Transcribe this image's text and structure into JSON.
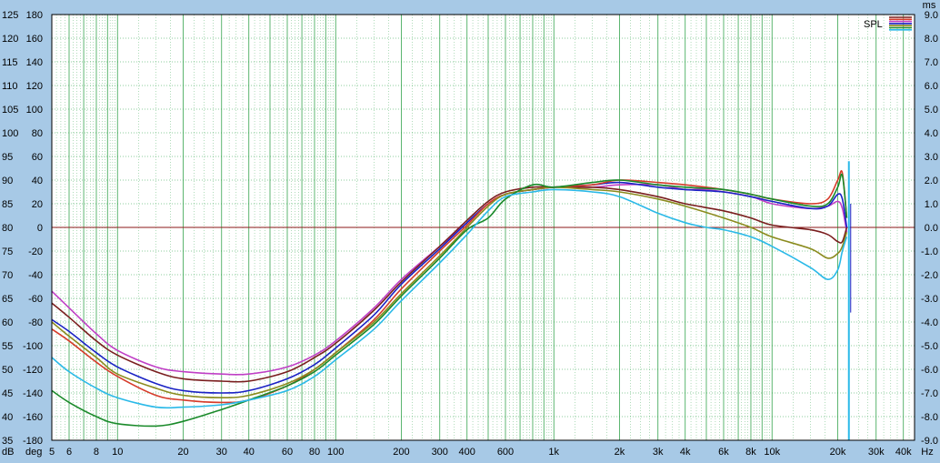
{
  "chart_data": {
    "type": "line",
    "x_scale": "log",
    "xlim": [
      5,
      45000
    ],
    "ylim_db": [
      35,
      125
    ],
    "ylim_deg": [
      -180,
      180
    ],
    "ylim_ms": [
      -9.0,
      9.0
    ],
    "left_units": [
      "dB",
      "deg"
    ],
    "right_unit": "ms",
    "x_unit": "Hz",
    "legend_label": "SPL",
    "colors": {
      "background": "#a7c9e6",
      "plot": "#ffffff",
      "grid": "#1f9a3a",
      "zero_line": "#8b1a1a"
    },
    "db_ticks": [
      "35",
      "40",
      "45",
      "50",
      "55",
      "60",
      "65",
      "70",
      "75",
      "80",
      "85",
      "90",
      "95",
      "100",
      "105",
      "110",
      "115",
      "120",
      "125"
    ],
    "deg_ticks": [
      "-180",
      "-160",
      "-140",
      "-120",
      "-100",
      "-80",
      "-60",
      "-40",
      "-20",
      "0",
      "20",
      "40",
      "60",
      "80",
      "100",
      "120",
      "140",
      "160",
      "180"
    ],
    "ms_ticks": [
      "-9.0",
      "-8.0",
      "-7.0",
      "-6.0",
      "-5.0",
      "-4.0",
      "-3.0",
      "-2.0",
      "-1.0",
      "0.0",
      "1.0",
      "2.0",
      "3.0",
      "4.0",
      "5.0",
      "6.0",
      "7.0",
      "8.0",
      "9.0"
    ],
    "x_ticks": [
      {
        "v": 5,
        "label": "5"
      },
      {
        "v": 6,
        "label": "6"
      },
      {
        "v": 8,
        "label": "8"
      },
      {
        "v": 10,
        "label": "10"
      },
      {
        "v": 20,
        "label": "20"
      },
      {
        "v": 30,
        "label": "30"
      },
      {
        "v": 40,
        "label": "40"
      },
      {
        "v": 60,
        "label": "60"
      },
      {
        "v": 80,
        "label": "80"
      },
      {
        "v": 100,
        "label": "100"
      },
      {
        "v": 200,
        "label": "200"
      },
      {
        "v": 300,
        "label": "300"
      },
      {
        "v": 400,
        "label": "400"
      },
      {
        "v": 600,
        "label": "600"
      },
      {
        "v": 1000,
        "label": "1k"
      },
      {
        "v": 2000,
        "label": "2k"
      },
      {
        "v": 3000,
        "label": "3k"
      },
      {
        "v": 4000,
        "label": "4k"
      },
      {
        "v": 6000,
        "label": "6k"
      },
      {
        "v": 8000,
        "label": "8k"
      },
      {
        "v": 10000,
        "label": "10k"
      },
      {
        "v": 20000,
        "label": "20k"
      },
      {
        "v": 30000,
        "label": "30k"
      },
      {
        "v": 40000,
        "label": "40k"
      }
    ],
    "series": [
      {
        "color": "#c03fc6",
        "points": [
          [
            5,
            66.5
          ],
          [
            6,
            63
          ],
          [
            8,
            57.5
          ],
          [
            10,
            54
          ],
          [
            15,
            50.5
          ],
          [
            20,
            49.5
          ],
          [
            30,
            49
          ],
          [
            40,
            49
          ],
          [
            60,
            50.5
          ],
          [
            80,
            53
          ],
          [
            100,
            56
          ],
          [
            150,
            63
          ],
          [
            200,
            69
          ],
          [
            300,
            76
          ],
          [
            400,
            81
          ],
          [
            500,
            85
          ],
          [
            600,
            87
          ],
          [
            800,
            88
          ],
          [
            1000,
            88.5
          ],
          [
            1500,
            88.5
          ],
          [
            2000,
            89
          ],
          [
            3000,
            89
          ],
          [
            4000,
            88
          ],
          [
            5000,
            88
          ],
          [
            8000,
            86.5
          ],
          [
            10000,
            85
          ],
          [
            15000,
            84
          ],
          [
            18000,
            84.5
          ],
          [
            20000,
            85.5
          ],
          [
            21000,
            84
          ],
          [
            22000,
            79
          ]
        ]
      },
      {
        "color": "#7a1f1f",
        "points": [
          [
            5,
            64
          ],
          [
            6,
            61
          ],
          [
            8,
            56
          ],
          [
            10,
            53
          ],
          [
            15,
            49.5
          ],
          [
            20,
            48
          ],
          [
            30,
            47.5
          ],
          [
            40,
            47.5
          ],
          [
            60,
            49.5
          ],
          [
            80,
            52.5
          ],
          [
            100,
            55.5
          ],
          [
            150,
            62.5
          ],
          [
            200,
            68.5
          ],
          [
            300,
            76
          ],
          [
            400,
            81.5
          ],
          [
            500,
            85.5
          ],
          [
            600,
            87.5
          ],
          [
            800,
            88.5
          ],
          [
            1000,
            88.5
          ],
          [
            1500,
            88.5
          ],
          [
            2000,
            88
          ],
          [
            3000,
            86.5
          ],
          [
            4000,
            85
          ],
          [
            6000,
            83.5
          ],
          [
            8000,
            82
          ],
          [
            10000,
            80.5
          ],
          [
            15000,
            79.5
          ],
          [
            18000,
            78.5
          ],
          [
            20000,
            77
          ],
          [
            21000,
            77
          ],
          [
            22000,
            80
          ]
        ]
      },
      {
        "color": "#1a22c4",
        "points": [
          [
            5,
            60.5
          ],
          [
            6,
            58
          ],
          [
            8,
            53.5
          ],
          [
            10,
            50.5
          ],
          [
            15,
            47
          ],
          [
            20,
            45.5
          ],
          [
            30,
            45
          ],
          [
            40,
            45.5
          ],
          [
            60,
            48
          ],
          [
            80,
            51
          ],
          [
            100,
            54.5
          ],
          [
            150,
            61.5
          ],
          [
            200,
            68
          ],
          [
            300,
            75.5
          ],
          [
            400,
            81
          ],
          [
            500,
            85
          ],
          [
            600,
            87
          ],
          [
            800,
            88
          ],
          [
            1000,
            88.5
          ],
          [
            1500,
            89
          ],
          [
            2000,
            89.5
          ],
          [
            3000,
            88.5
          ],
          [
            4000,
            88
          ],
          [
            6000,
            87.5
          ],
          [
            8000,
            86.5
          ],
          [
            10000,
            85.5
          ],
          [
            15000,
            84
          ],
          [
            18000,
            84.5
          ],
          [
            20000,
            87
          ],
          [
            21000,
            86
          ],
          [
            22000,
            80
          ]
        ]
      },
      {
        "color": "#d63b2a",
        "points": [
          [
            5,
            58.5
          ],
          [
            6,
            56
          ],
          [
            8,
            51.5
          ],
          [
            10,
            48.5
          ],
          [
            15,
            44.5
          ],
          [
            20,
            43.5
          ],
          [
            30,
            43
          ],
          [
            40,
            43.5
          ],
          [
            60,
            46.5
          ],
          [
            80,
            50
          ],
          [
            100,
            53.5
          ],
          [
            150,
            60.5
          ],
          [
            200,
            67
          ],
          [
            300,
            75
          ],
          [
            400,
            80.5
          ],
          [
            500,
            85
          ],
          [
            600,
            87
          ],
          [
            800,
            88
          ],
          [
            1000,
            88.5
          ],
          [
            1500,
            89
          ],
          [
            2000,
            90
          ],
          [
            3000,
            89.5
          ],
          [
            4000,
            89
          ],
          [
            6000,
            88
          ],
          [
            8000,
            87
          ],
          [
            10000,
            86
          ],
          [
            15000,
            85
          ],
          [
            18000,
            86
          ],
          [
            20000,
            90
          ],
          [
            21000,
            91.5
          ],
          [
            22000,
            82
          ]
        ]
      },
      {
        "color": "#8b8b1e",
        "points": [
          [
            5,
            60
          ],
          [
            6,
            57
          ],
          [
            8,
            52.5
          ],
          [
            10,
            49
          ],
          [
            15,
            46
          ],
          [
            20,
            44.5
          ],
          [
            30,
            44
          ],
          [
            40,
            44.5
          ],
          [
            60,
            47
          ],
          [
            80,
            50
          ],
          [
            100,
            53.5
          ],
          [
            150,
            60
          ],
          [
            200,
            66
          ],
          [
            300,
            74
          ],
          [
            400,
            80
          ],
          [
            500,
            84.5
          ],
          [
            600,
            87
          ],
          [
            800,
            88
          ],
          [
            1000,
            88.5
          ],
          [
            1500,
            88
          ],
          [
            2000,
            87.5
          ],
          [
            3000,
            86
          ],
          [
            4000,
            84.5
          ],
          [
            6000,
            82
          ],
          [
            8000,
            80
          ],
          [
            10000,
            78
          ],
          [
            15000,
            75.5
          ],
          [
            18000,
            73.5
          ],
          [
            20000,
            74.5
          ],
          [
            21000,
            76
          ],
          [
            22000,
            79
          ]
        ]
      },
      {
        "color": "#1a8a2a",
        "points": [
          [
            5,
            45.5
          ],
          [
            6,
            43
          ],
          [
            8,
            40
          ],
          [
            10,
            38.5
          ],
          [
            15,
            38
          ],
          [
            20,
            39
          ],
          [
            30,
            41.5
          ],
          [
            40,
            43.5
          ],
          [
            60,
            46.5
          ],
          [
            80,
            49.5
          ],
          [
            100,
            53
          ],
          [
            150,
            59.5
          ],
          [
            200,
            65.5
          ],
          [
            300,
            73.5
          ],
          [
            400,
            79.5
          ],
          [
            500,
            82
          ],
          [
            600,
            86
          ],
          [
            800,
            89
          ],
          [
            1000,
            88.5
          ],
          [
            1500,
            89.5
          ],
          [
            2000,
            90
          ],
          [
            3000,
            89
          ],
          [
            4000,
            88.5
          ],
          [
            6000,
            88
          ],
          [
            8000,
            87
          ],
          [
            10000,
            86
          ],
          [
            15000,
            84.5
          ],
          [
            18000,
            85
          ],
          [
            20000,
            88.5
          ],
          [
            21000,
            91
          ],
          [
            22000,
            82
          ]
        ]
      },
      {
        "color": "#2ab9e8",
        "points": [
          [
            5,
            52.5
          ],
          [
            6,
            49.5
          ],
          [
            8,
            46
          ],
          [
            10,
            44
          ],
          [
            15,
            42
          ],
          [
            20,
            42
          ],
          [
            30,
            42.5
          ],
          [
            40,
            43.5
          ],
          [
            60,
            45.5
          ],
          [
            80,
            48.5
          ],
          [
            100,
            52
          ],
          [
            150,
            58.5
          ],
          [
            200,
            64.5
          ],
          [
            300,
            72.5
          ],
          [
            400,
            78.5
          ],
          [
            500,
            83.5
          ],
          [
            600,
            86.5
          ],
          [
            800,
            87.5
          ],
          [
            1000,
            88
          ],
          [
            1500,
            87.5
          ],
          [
            2000,
            86.5
          ],
          [
            3000,
            83
          ],
          [
            4000,
            81
          ],
          [
            5000,
            80
          ],
          [
            6000,
            79.5
          ],
          [
            8000,
            78
          ],
          [
            10000,
            76
          ],
          [
            15000,
            71.5
          ],
          [
            18000,
            69
          ],
          [
            20000,
            71
          ],
          [
            21000,
            75
          ],
          [
            22000,
            78
          ]
        ]
      }
    ]
  }
}
